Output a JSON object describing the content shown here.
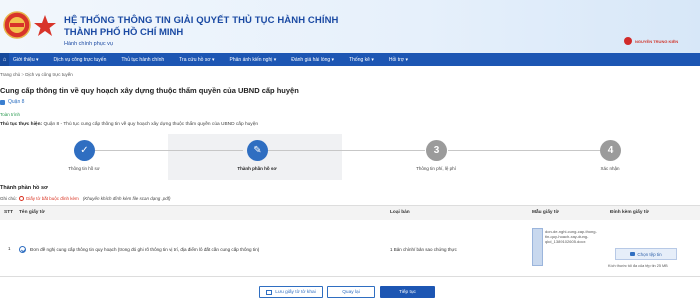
{
  "header": {
    "title_line1": "HỆ THỐNG THÔNG TIN GIẢI QUYẾT THỦ TỤC HÀNH CHÍNH",
    "title_line2": "THÀNH PHỐ HỒ CHÍ MINH",
    "subtitle": "Hành chính phục vụ",
    "user_name": "NGUYỄN TRUNG KIÊN"
  },
  "nav": {
    "home_icon": "home-icon",
    "items": [
      "Giới thiệu ▾",
      "Dịch vụ công trực tuyến",
      "Thủ tục hành chính",
      "Tra cứu hồ sơ ▾",
      "Phản ánh kiến nghị ▾",
      "Đánh giá hài lòng ▾",
      "Thống kê ▾",
      "Hỏi trợ ▾"
    ]
  },
  "breadcrumb": {
    "home": "Trang chủ",
    "sep": " > ",
    "current": "Dịch vụ công trực tuyến"
  },
  "page": {
    "title": "Cung cấp thông tin về quy hoạch xây dựng thuộc thẩm quyền của UBND cấp huyện",
    "agency": "Quận 8",
    "completed": "Toàn trình",
    "procedure_label": "Thủ tục thực hiện:",
    "procedure_value": " Quận 8 - Thủ tục cung cấp thông tin về quy hoạch xây dựng thuộc thẩm quyền của UBND cấp huyện"
  },
  "steps": [
    {
      "label": "Thông tin hồ sơ",
      "state": "done",
      "glyph": "✓"
    },
    {
      "label": "Thành phần hồ sơ",
      "state": "active",
      "glyph": "✎"
    },
    {
      "label": "Thông tin phí, lệ phí",
      "state": "todo",
      "glyph": "3"
    },
    {
      "label": "Xác nhận",
      "state": "todo",
      "glyph": "4"
    }
  ],
  "files_section": {
    "title": "Thành phần hồ sơ",
    "note_label": "Ghi chú:",
    "note_required": "Giấy tờ bắt buộc đính kèm",
    "note_hint": "(Khuyến khích đính kèm file scan dạng .pdf)"
  },
  "table": {
    "headers": {
      "stt": "STT",
      "name": "Tên giấy tờ",
      "type": "Loại bản",
      "template": "Mẫu giấy tờ",
      "attach": "Đính kèm giấy tờ"
    },
    "rows": [
      {
        "stt": "1",
        "name": "Đơn đề nghị cung cấp thông tin quy hoạch (trong đó ghi rõ thông tin vị trí, địa điểm lô đất cần cung cấp thông tin)",
        "type": "1 Bản chính/ bản sao chứng thực",
        "template_file": "don-de-nghi-cung-cap-thong-tin-quy-hoach-xay-dung-qkd_1389102605.docx",
        "choose_label": "Chọn tệp tin",
        "size_note": "Kích thước tối đa của tệp tin 25 MB"
      }
    ]
  },
  "footer": {
    "save_label": "Lưu giấy tờ tờ khai",
    "back_label": "Quay lại",
    "next_label": "Tiếp tục"
  },
  "colors": {
    "primary": "#1d56b3",
    "brand_title": "#1b4aa3",
    "required": "#d9301f",
    "done_step": "#2f6ec1",
    "todo_step": "#9b9b9b"
  }
}
